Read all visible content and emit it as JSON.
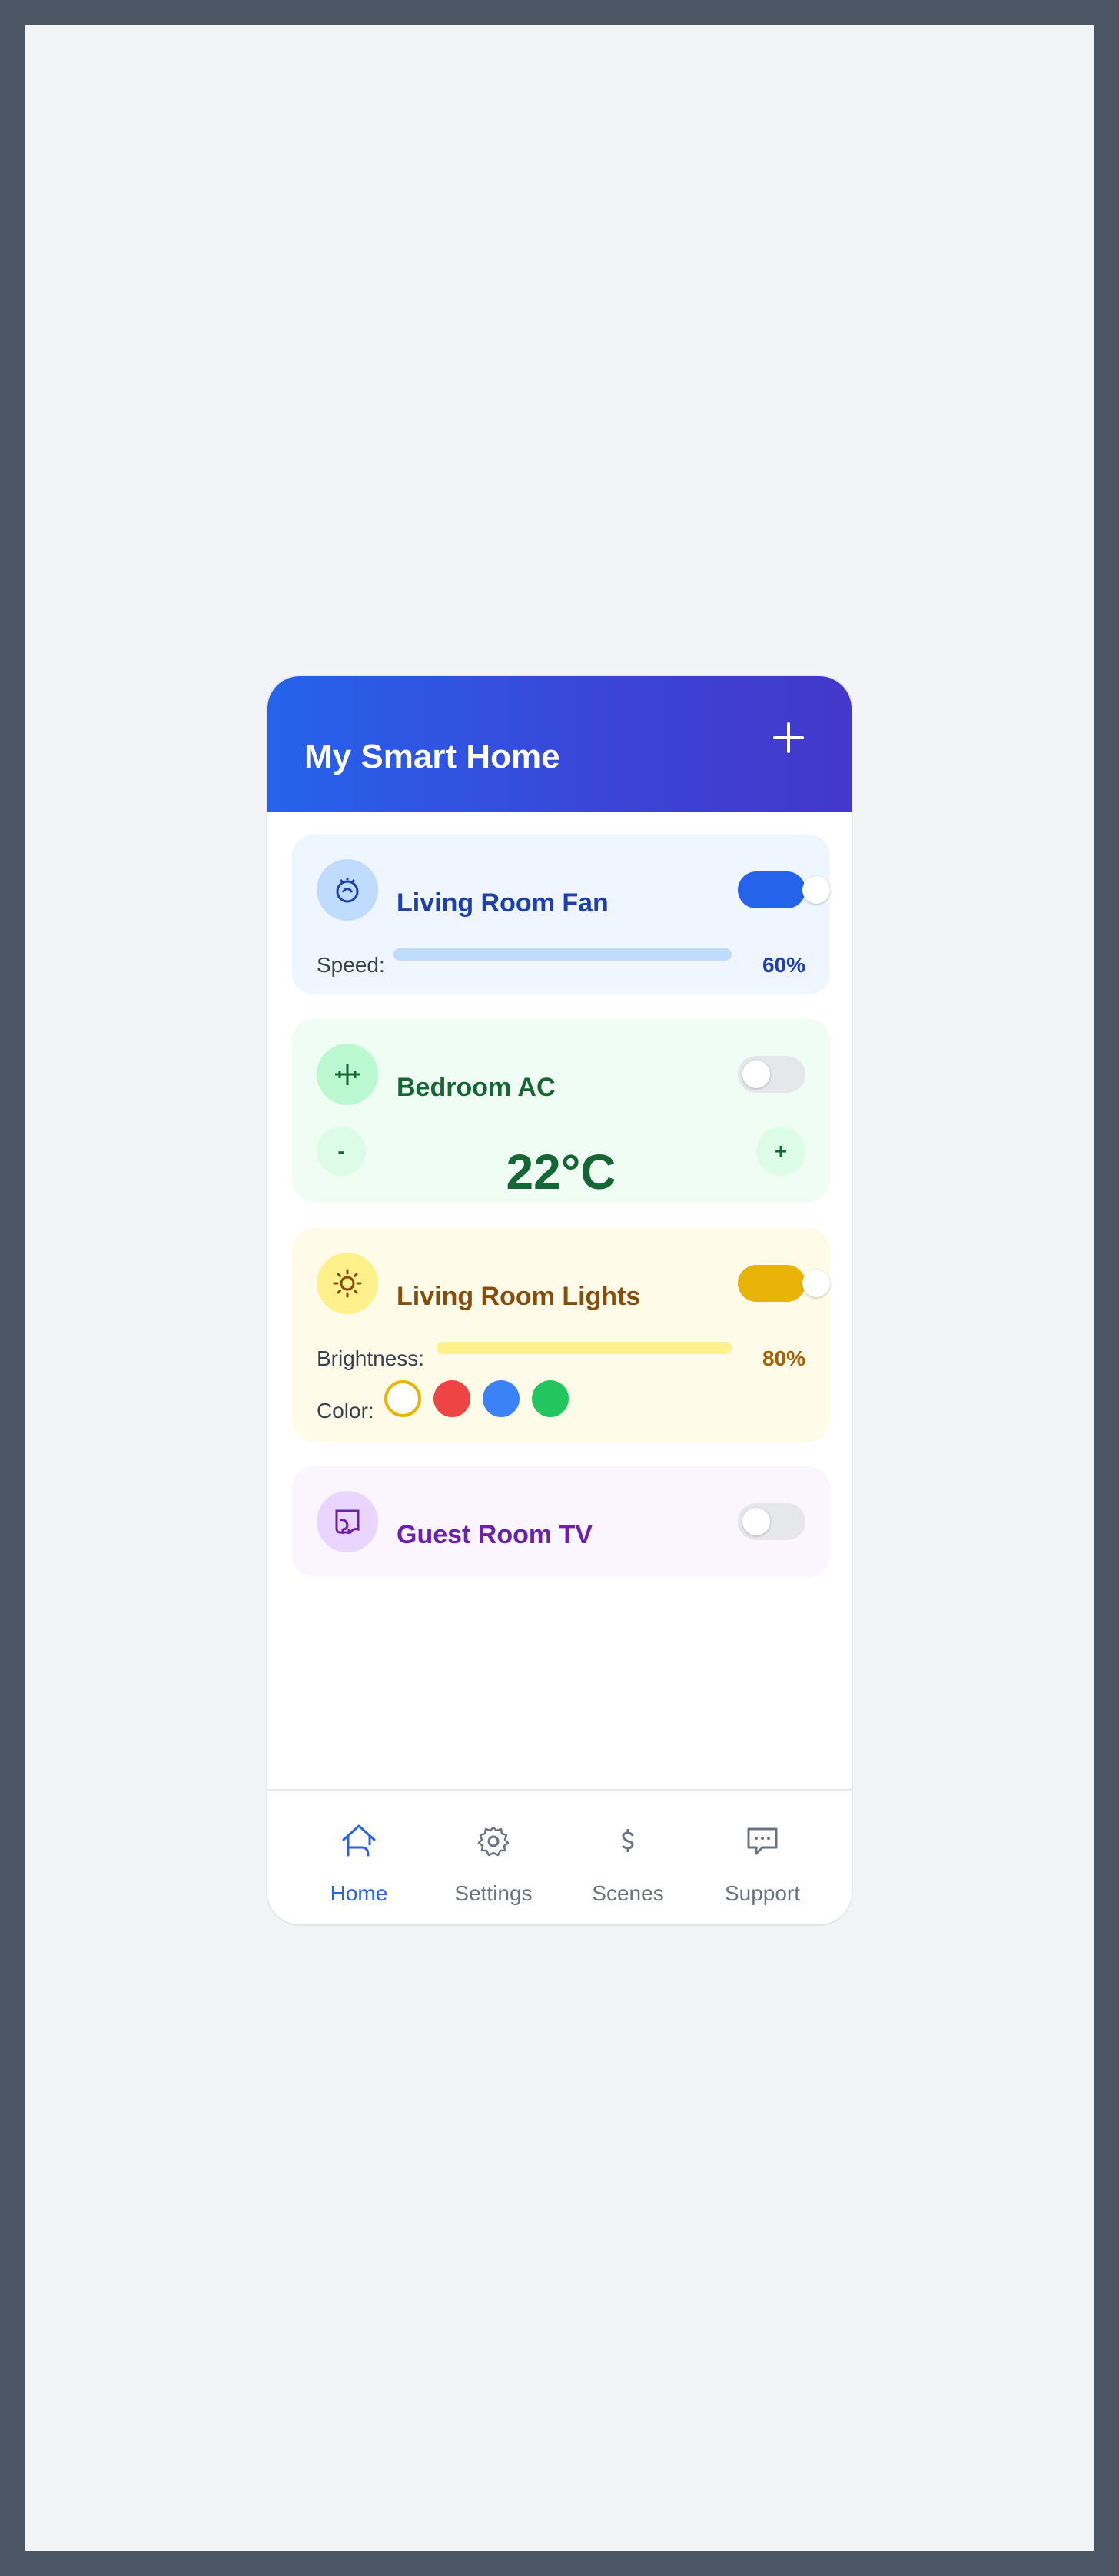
{
  "header": {
    "title": "My Smart Home",
    "add_icon": "plus-icon"
  },
  "devices": {
    "fan": {
      "name": "Living Room Fan",
      "icon": "fan-icon",
      "on": true,
      "speed_label": "Speed:",
      "speed_value": "60%",
      "speed_fraction": 0.6,
      "accent": "#2563eb"
    },
    "ac": {
      "name": "Bedroom AC",
      "icon": "ac-icon",
      "on": false,
      "temperature": "22°C",
      "decrease_label": "-",
      "increase_label": "+",
      "accent": "#166534"
    },
    "lights": {
      "name": "Living Room Lights",
      "icon": "sun-icon",
      "on": true,
      "brightness_label": "Brightness:",
      "brightness_value": "80%",
      "brightness_fraction": 0.8,
      "color_label": "Color:",
      "colors": [
        "#ffffff",
        "#ef4444",
        "#3b82f6",
        "#22c55e"
      ],
      "selected_color_index": 0,
      "accent": "#eab308"
    },
    "tv": {
      "name": "Guest Room TV",
      "icon": "tv-icon",
      "on": false,
      "accent": "#6b21a8"
    }
  },
  "nav": {
    "items": [
      {
        "label": "Home",
        "icon": "home-icon",
        "active": true
      },
      {
        "label": "Settings",
        "icon": "gear-icon",
        "active": false
      },
      {
        "label": "Scenes",
        "icon": "dollar-icon",
        "active": false
      },
      {
        "label": "Support",
        "icon": "chat-icon",
        "active": false
      }
    ],
    "active_color": "#2563eb",
    "inactive_color": "#6b7280"
  }
}
